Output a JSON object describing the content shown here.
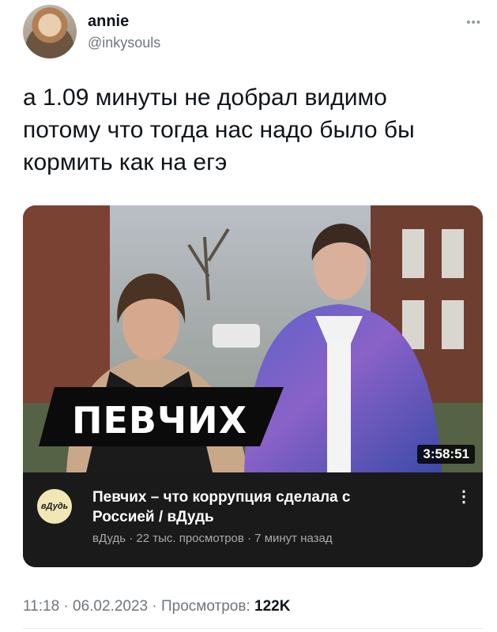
{
  "tweet": {
    "display_name": "annie",
    "handle": "@inkysouls",
    "text": "а 1.09 минуты не добрал видимо\nпотому что тогда нас надо было бы\nкормить как на егэ",
    "more_icon": "•••"
  },
  "video_card": {
    "overlay_text": "ПЕВЧИХ",
    "duration": "3:58:51",
    "channel_avatar_text": "вДудь",
    "title": "Певчих – что коррупция сделала с\nРоссией / вДудь",
    "meta": "вДудь · 22 тыс. просмотров · 7 минут назад",
    "more_icon": "⋮"
  },
  "footer": {
    "timestamp": "11:18 · 06.02.2023 · Просмотров: ",
    "views": "122K"
  }
}
